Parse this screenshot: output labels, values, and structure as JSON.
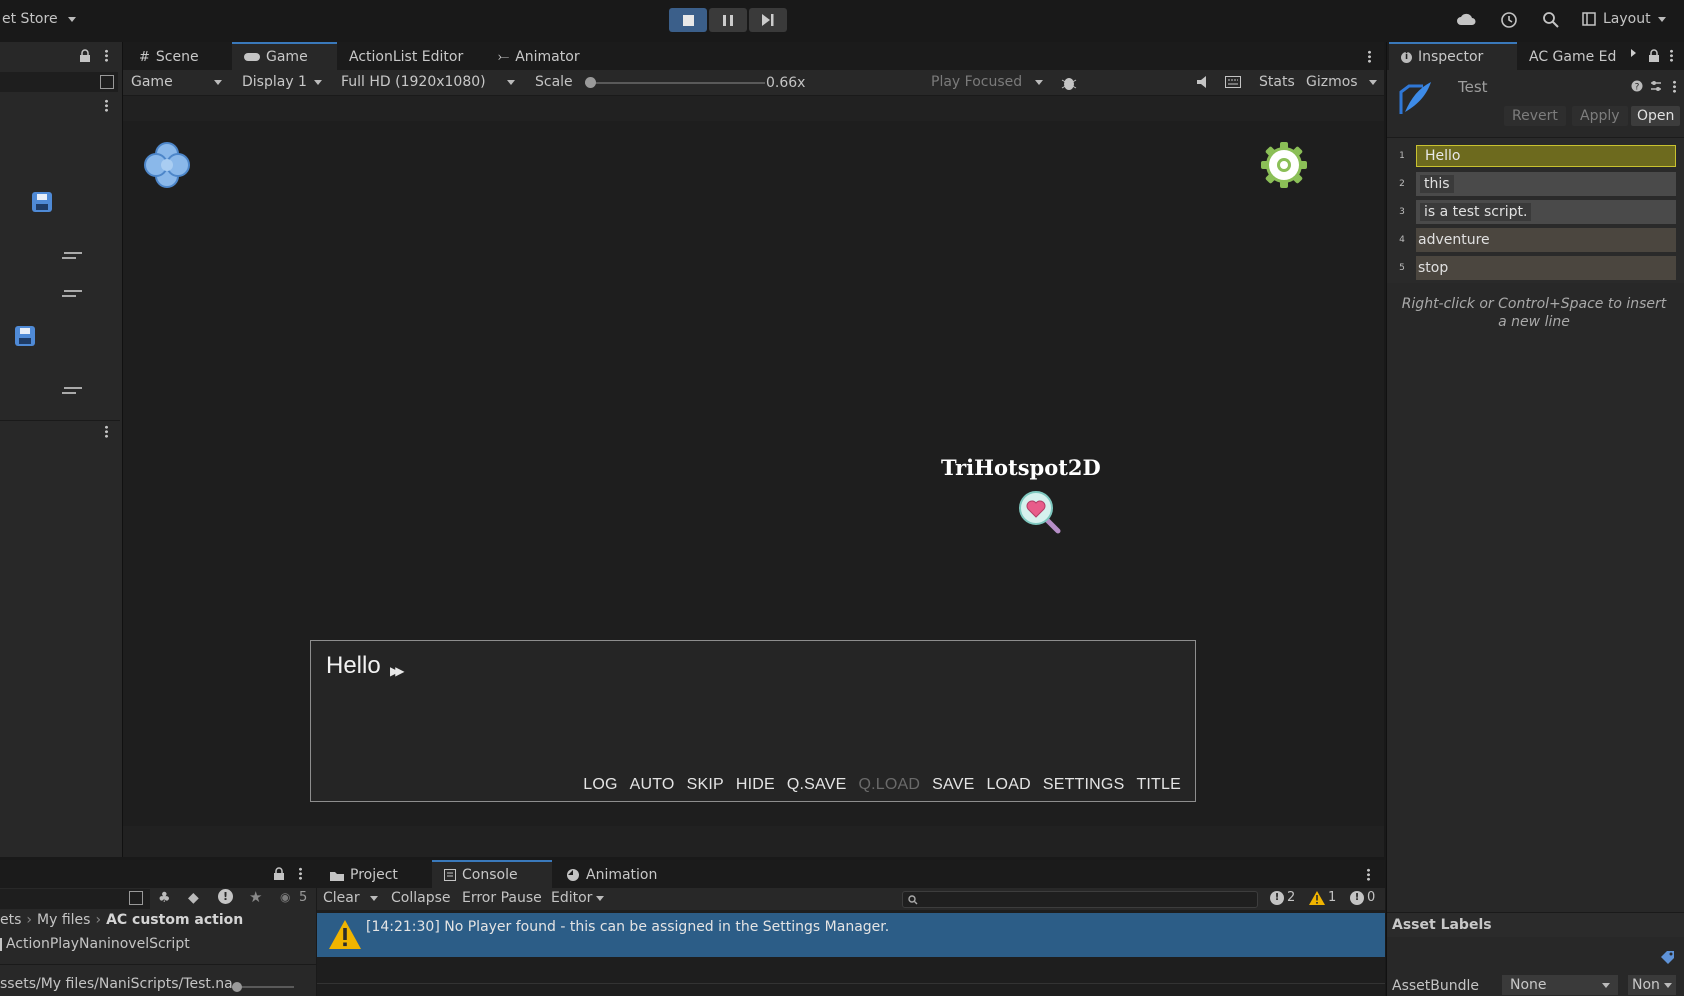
{
  "toolbar": {
    "store_label": "et Store",
    "layout_label": "Layout"
  },
  "game_tabs": {
    "scene": "Scene",
    "game": "Game",
    "actionlist": "ActionList Editor",
    "animator": "Animator"
  },
  "game_bar": {
    "view": "Game",
    "display": "Display 1",
    "resolution": "Full HD (1920x1080)",
    "scale_label": "Scale",
    "scale_value": "0.66x",
    "play_mode": "Play Focused",
    "stats": "Stats",
    "gizmos": "Gizmos"
  },
  "scale_level": 0.0,
  "game_view": {
    "hotspot_label": "TriHotspot2D",
    "dialogue_text": "Hello",
    "buttons": [
      "LOG",
      "AUTO",
      "SKIP",
      "HIDE",
      "Q.SAVE",
      "Q.LOAD",
      "SAVE",
      "LOAD",
      "SETTINGS",
      "TITLE"
    ]
  },
  "inspector": {
    "tab": "Inspector",
    "tab2": "AC Game Edit",
    "asset_name": "Test",
    "revert": "Revert",
    "apply": "Apply",
    "open": "Open",
    "lines": [
      {
        "n": "1",
        "text": "Hello"
      },
      {
        "n": "2",
        "text": "this"
      },
      {
        "n": "3",
        "text": "is a test script."
      },
      {
        "n": "4",
        "text": "adventure"
      },
      {
        "n": "5",
        "text": "stop"
      }
    ],
    "hint": "Right-click or Control+Space to insert a new line",
    "asset_labels": "Asset Labels",
    "assetbundle_label": "AssetBundle",
    "assetbundle_value": "None",
    "variant_value": "Non"
  },
  "bottom_tabs": {
    "project": "Project",
    "console": "Console",
    "animation": "Animation"
  },
  "console": {
    "clear": "Clear",
    "collapse": "Collapse",
    "error_pause": "Error Pause",
    "editor": "Editor",
    "hidden_count": "5",
    "log_count": "2",
    "warn_count": "1",
    "error_count": "0",
    "message": "[14:21:30] No Player found - this can be assigned in the Settings Manager."
  },
  "project": {
    "breadcrumb": [
      "ets",
      "My files",
      "AC custom action"
    ],
    "item": "ActionPlayNaninovelScript",
    "path": "ssets/My files/NaniScripts/Test.na"
  },
  "colors": {
    "accent": "#3a79bb",
    "highlight": "#6d6a1e",
    "console_selected": "#2c5d87"
  }
}
